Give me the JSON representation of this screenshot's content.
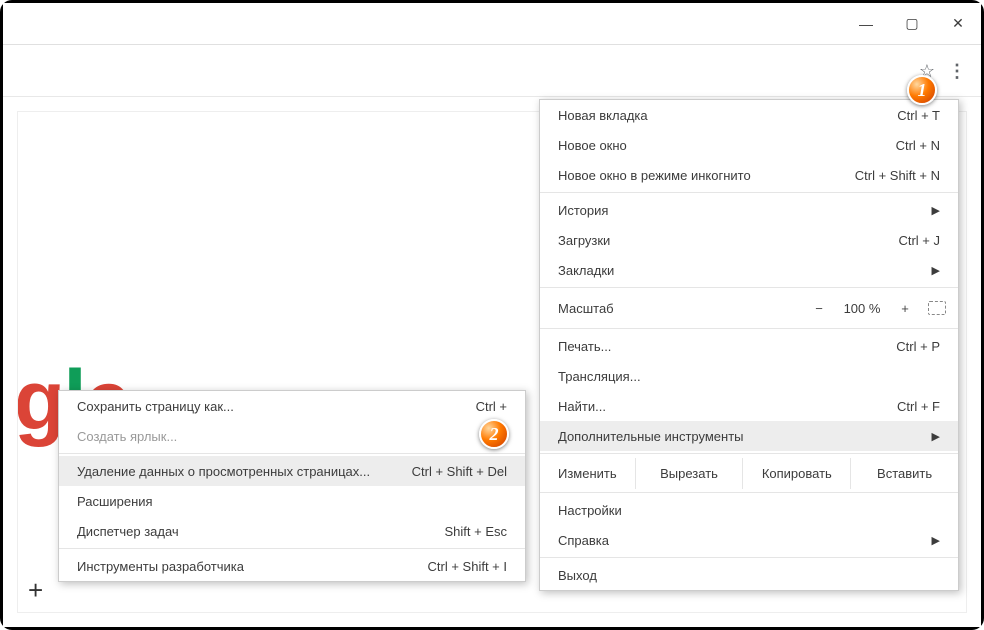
{
  "window": {
    "minimize_glyph": "—",
    "maximize_glyph": "▢",
    "close_glyph": "✕"
  },
  "toolbar": {
    "star_glyph": "☆",
    "kebab_glyph": "⋮"
  },
  "logo": {
    "part1": "g",
    "part2": "l",
    "part3": "e"
  },
  "plus_glyph": "+",
  "callouts": {
    "one": "1",
    "two": "2"
  },
  "main_menu": {
    "new_tab": {
      "label": "Новая вкладка",
      "shortcut": "Ctrl + T"
    },
    "new_window": {
      "label": "Новое окно",
      "shortcut": "Ctrl + N"
    },
    "incognito": {
      "label": "Новое окно в режиме инкогнито",
      "shortcut": "Ctrl + Shift + N"
    },
    "history": {
      "label": "История",
      "arrow": "▶"
    },
    "downloads": {
      "label": "Загрузки",
      "shortcut": "Ctrl + J"
    },
    "bookmarks": {
      "label": "Закладки",
      "arrow": "▶"
    },
    "zoom": {
      "label": "Масштаб",
      "minus": "−",
      "value": "100 %",
      "plus": "+"
    },
    "print": {
      "label": "Печать...",
      "shortcut": "Ctrl + P"
    },
    "cast": {
      "label": "Трансляция..."
    },
    "find": {
      "label": "Найти...",
      "shortcut": "Ctrl + F"
    },
    "more_tools": {
      "label": "Дополнительные инструменты",
      "arrow": "▶"
    },
    "edit": {
      "label": "Изменить",
      "cut": "Вырезать",
      "copy": "Копировать",
      "paste": "Вставить"
    },
    "settings": {
      "label": "Настройки"
    },
    "help": {
      "label": "Справка",
      "arrow": "▶"
    },
    "exit": {
      "label": "Выход"
    }
  },
  "sub_menu": {
    "save_as": {
      "label": "Сохранить страницу как...",
      "shortcut": "Ctrl +"
    },
    "create_shortcut": {
      "label": "Создать ярлык..."
    },
    "clear_data": {
      "label": "Удаление данных о просмотренных страницах...",
      "shortcut": "Ctrl + Shift + Del"
    },
    "extensions": {
      "label": "Расширения"
    },
    "task_manager": {
      "label": "Диспетчер задач",
      "shortcut": "Shift + Esc"
    },
    "dev_tools": {
      "label": "Инструменты разработчика",
      "shortcut": "Ctrl + Shift + I"
    }
  }
}
